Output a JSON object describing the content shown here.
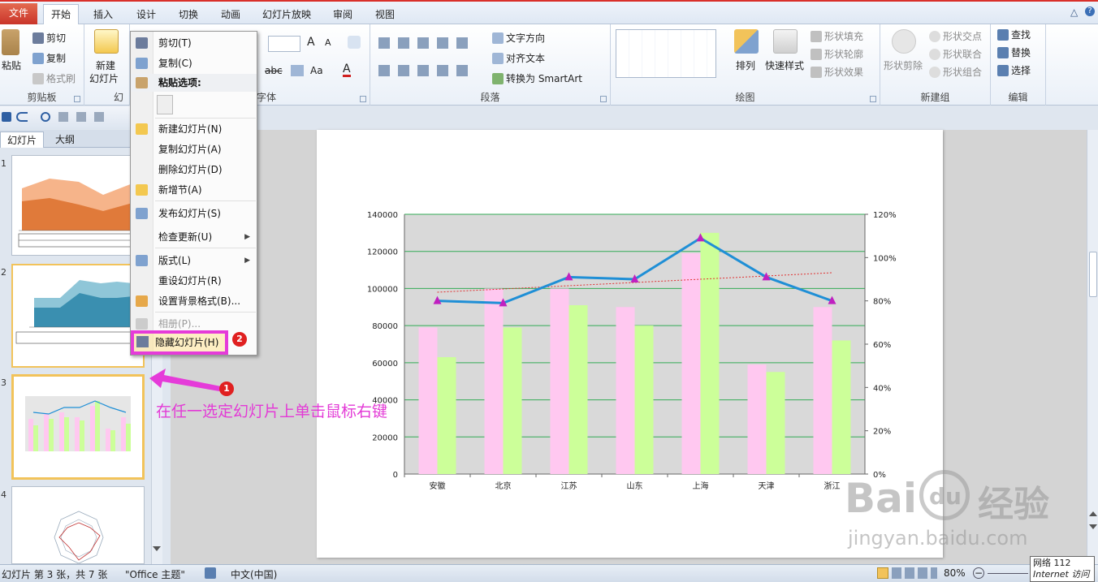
{
  "tabs": [
    "文件",
    "开始",
    "插入",
    "设计",
    "切换",
    "动画",
    "幻灯片放映",
    "审阅",
    "视图"
  ],
  "active_tab": "开始",
  "window_controls": [
    "△",
    "?"
  ],
  "ribbon": {
    "clipboard": {
      "label": "剪贴板",
      "paste": "粘贴",
      "cut": "剪切",
      "copy": "复制",
      "format_painter": "格式刷"
    },
    "slides": {
      "label": "幻",
      "new_slide": "新建",
      "new_slide2": "幻灯片"
    },
    "font": {
      "label": "字体",
      "size_up": "A",
      "size_down": "A",
      "abc": "abc",
      "aa": "Aa",
      "a_color": "A"
    },
    "paragraph": {
      "label": "段落",
      "text_direction": "文字方向",
      "align_text": "对齐文本",
      "smartart": "转换为 SmartArt"
    },
    "drawing": {
      "label": "绘图",
      "arrange": "排列",
      "quick_styles": "快速样式",
      "fill": "形状填充",
      "outline": "形状轮廓",
      "effects": "形状效果"
    },
    "new_group": {
      "label": "新建组",
      "clip": "形状剪除",
      "intersect": "形状交点",
      "union": "形状联合",
      "combine": "形状组合"
    },
    "editing": {
      "label": "编辑",
      "find": "查找",
      "replace": "替换",
      "select": "选择"
    }
  },
  "left_panel": {
    "tabs": [
      "幻灯片",
      "大纲"
    ],
    "slide_numbers": [
      "1",
      "2",
      "3",
      "4"
    ]
  },
  "context_menu": {
    "items": [
      {
        "label": "剪切(T)",
        "disabled": false
      },
      {
        "label": "复制(C)",
        "disabled": false
      },
      {
        "label": "粘贴选项:",
        "header": true
      },
      {
        "label": "新建幻灯片(N)",
        "disabled": false
      },
      {
        "label": "复制幻灯片(A)",
        "disabled": false
      },
      {
        "label": "删除幻灯片(D)",
        "disabled": false
      },
      {
        "label": "新增节(A)",
        "disabled": false
      },
      {
        "label": "发布幻灯片(S)",
        "disabled": false
      },
      {
        "label": "检查更新(U)",
        "disabled": false,
        "submenu": true
      },
      {
        "label": "版式(L)",
        "disabled": false,
        "submenu": true
      },
      {
        "label": "重设幻灯片(R)",
        "disabled": false
      },
      {
        "label": "设置背景格式(B)...",
        "disabled": false
      },
      {
        "label": "相册(P)...",
        "disabled": true
      },
      {
        "label": "隐藏幻灯片(H)",
        "disabled": false,
        "highlighted": true
      }
    ]
  },
  "annotation": {
    "text": "在任一选定幻灯片上单击鼠标右键",
    "badge1": "1",
    "badge2": "2"
  },
  "chart_data": {
    "type": "bar",
    "categories": [
      "安徽",
      "北京",
      "江苏",
      "山东",
      "上海",
      "天津",
      "浙江"
    ],
    "series": [
      {
        "values": [
          79000,
          100000,
          100000,
          90000,
          119000,
          59000,
          90000
        ],
        "color": "#ffc8f0"
      },
      {
        "values": [
          63000,
          79000,
          91000,
          80000,
          130000,
          55000,
          72000
        ],
        "color": "#ccff99"
      }
    ],
    "line_series": {
      "values": [
        0.8,
        0.79,
        0.91,
        0.9,
        1.09,
        0.91,
        0.8
      ],
      "color": "#1f8fd6",
      "marker_color": "#c020c0"
    },
    "trendline": {
      "from": 0.84,
      "to": 0.93,
      "color": "#e03030"
    },
    "ylim": [
      0,
      140000
    ],
    "y_ticks": [
      "0",
      "20000",
      "40000",
      "60000",
      "80000",
      "100000",
      "120000",
      "140000"
    ],
    "y2_ticks": [
      "0%",
      "20%",
      "40%",
      "60%",
      "80%",
      "100%",
      "120%"
    ],
    "grid": true,
    "plot_bg": "#d9d9d9",
    "grid_color": "#33aa55"
  },
  "status": {
    "slide_info": "幻灯片 第 3 张，共 7 张",
    "theme": "\"Office 主题\"",
    "language": "中文(中国)",
    "zoom": "80%"
  },
  "tooltip": {
    "line1": "网络 112",
    "line2": "Internet 访问"
  },
  "watermark": {
    "brand": "Bai",
    "logo": "du",
    "cn": "经验",
    "url": "jingyan.baidu.com"
  }
}
